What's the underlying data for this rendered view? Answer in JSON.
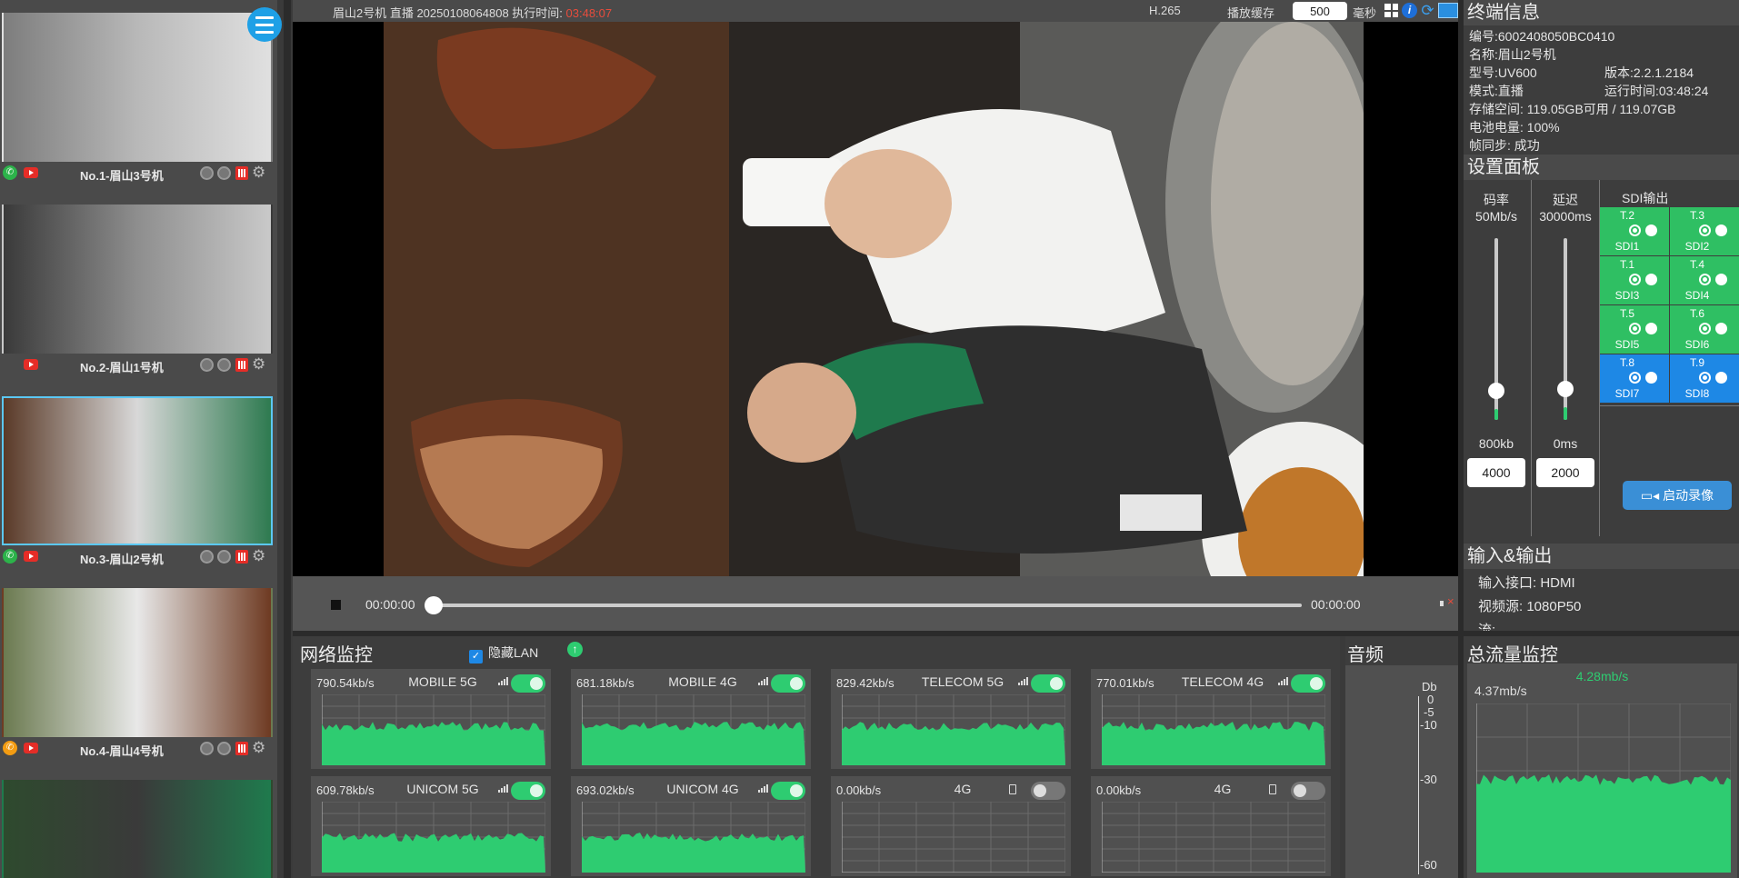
{
  "sidebar": {
    "cameras": [
      {
        "name": "No.1-眉山3号机",
        "phone_color": "green",
        "selected": false
      },
      {
        "name": "No.2-眉山1号机",
        "phone_color": "none",
        "selected": false
      },
      {
        "name": "No.3-眉山2号机",
        "phone_color": "green",
        "selected": true
      },
      {
        "name": "No.4-眉山4号机",
        "phone_color": "orange",
        "selected": false
      }
    ]
  },
  "topbar": {
    "title": "眉山2号机 直播 20250108064808 执行时间: ",
    "elapsed": "03:48:07",
    "codec": "H.265",
    "buffer_label": "播放缓存",
    "buffer_value": "500",
    "buffer_unit": "毫秒"
  },
  "player": {
    "current_time": "00:00:00",
    "end_time": "00:00:00",
    "progress": 0
  },
  "terminal_info": {
    "title": "终端信息",
    "serial": "编号:6002408050BC0410",
    "name": "名称:眉山2号机",
    "model": "型号:UV600",
    "version": "版本:2.2.1.2184",
    "mode": "模式:直播",
    "runtime": "运行时间:03:48:24",
    "storage": "存储空间:  119.05GB可用 / 119.07GB",
    "battery": "电池电量: 100%",
    "frame_sync": "帧同步: 成功"
  },
  "settings": {
    "title": "设置面板",
    "bitrate": {
      "label": "码率",
      "max": "50Mb/s",
      "min": "800kb",
      "value": "4000",
      "level": 0.06
    },
    "delay": {
      "label": "延迟",
      "max": "30000ms",
      "min": "0ms",
      "value": "2000",
      "level": 0.07
    },
    "sdi_title": "SDI输出",
    "sdi": [
      {
        "t": "T.2",
        "s": "SDI1",
        "active": false
      },
      {
        "t": "T.3",
        "s": "SDI2",
        "active": false
      },
      {
        "t": "T.1",
        "s": "SDI3",
        "active": false
      },
      {
        "t": "T.4",
        "s": "SDI4",
        "active": false
      },
      {
        "t": "T.5",
        "s": "SDI5",
        "active": false
      },
      {
        "t": "T.6",
        "s": "SDI6",
        "active": false
      },
      {
        "t": "T.8",
        "s": "SDI7",
        "active": true
      },
      {
        "t": "T.9",
        "s": "SDI8",
        "active": true
      }
    ],
    "record_button": "启动录像"
  },
  "io": {
    "title": "输入&输出",
    "input_port": "输入接口: HDMI",
    "video_source": "视频源: 1080P50",
    "stream": "流:"
  },
  "network": {
    "title": "网络监控",
    "hide_lan_label": "隐藏LAN",
    "hide_lan_checked": true,
    "cards": [
      {
        "rate": "790.54kb/s",
        "name": "MOBILE 5G",
        "on": true,
        "icon": "signal-icon",
        "level": 0.55
      },
      {
        "rate": "681.18kb/s",
        "name": "MOBILE 4G",
        "on": true,
        "icon": "signal-icon",
        "level": 0.55
      },
      {
        "rate": "829.42kb/s",
        "name": "TELECOM 5G",
        "on": true,
        "icon": "signal-icon",
        "level": 0.55
      },
      {
        "rate": "770.01kb/s",
        "name": "TELECOM 4G",
        "on": true,
        "icon": "signal-icon",
        "level": 0.55
      },
      {
        "rate": "609.78kb/s",
        "name": "UNICOM 5G",
        "on": true,
        "icon": "signal-icon",
        "level": 0.5
      },
      {
        "rate": "693.02kb/s",
        "name": "UNICOM 4G",
        "on": true,
        "icon": "signal-icon",
        "level": 0.5
      },
      {
        "rate": "0.00kb/s",
        "name": "4G",
        "on": false,
        "icon": "sim-icon",
        "level": 0
      },
      {
        "rate": "0.00kb/s",
        "name": "4G",
        "on": false,
        "icon": "sim-icon",
        "level": 0
      }
    ]
  },
  "audio": {
    "title": "音频",
    "unit": "Db",
    "ticks": [
      "0",
      "-5",
      "-10",
      "-30",
      "-60"
    ]
  },
  "traffic": {
    "title": "总流量监控",
    "current": "4.28mb/s",
    "max": "4.37mb/s",
    "level": 0.55
  }
}
